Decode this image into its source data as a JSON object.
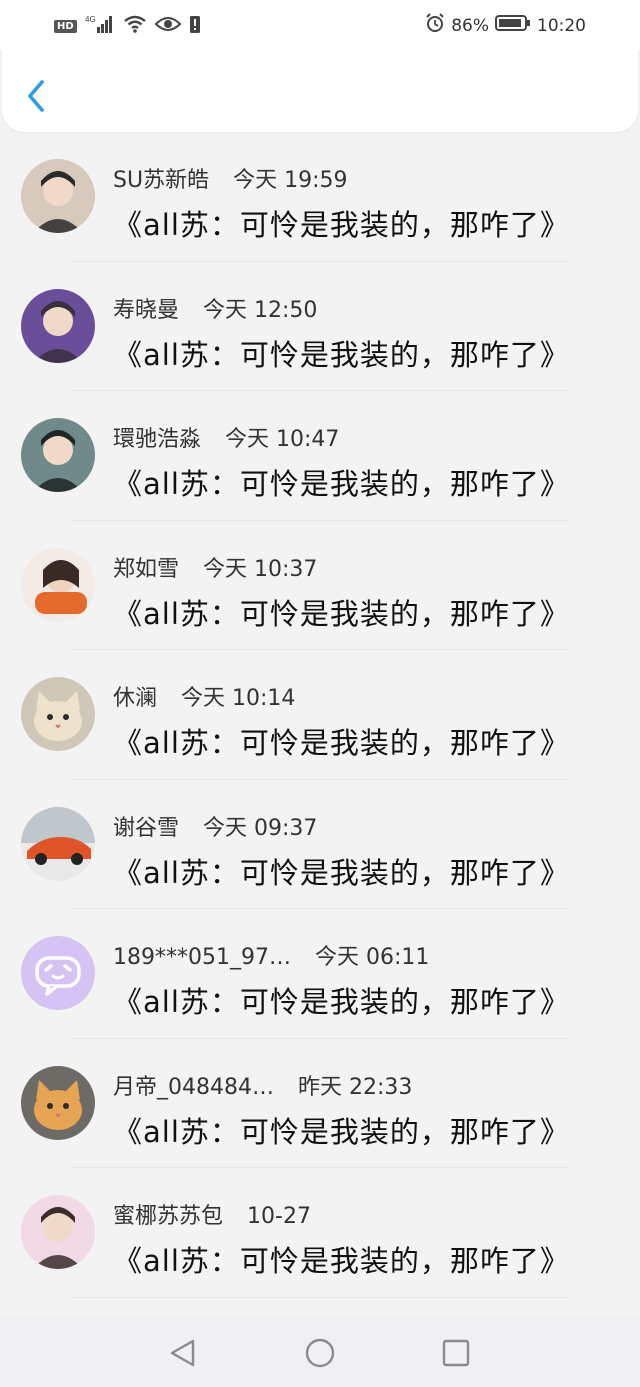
{
  "status_bar": {
    "left_badge": "HD",
    "network": "4G",
    "battery_percent": "86%",
    "time": "10:20"
  },
  "rows": [
    {
      "name": "SU苏新皓",
      "time": "今天 19:59",
      "message": "《all苏：可怜是我装的，那咋了》",
      "avatar": {
        "bg": "#d8c9bd",
        "fg": "#2a2a2a",
        "type": "boy-dark-hair"
      }
    },
    {
      "name": "寿晓曼",
      "time": "今天 12:50",
      "message": "《all苏：可怜是我装的，那咋了》",
      "avatar": {
        "bg": "#6a4e9a",
        "fg": "#3a2f3f",
        "type": "boy-purple"
      }
    },
    {
      "name": "環驰浩淼",
      "time": "今天 10:47",
      "message": "《all苏：可怜是我装的，那咋了》",
      "avatar": {
        "bg": "#6f8a88",
        "fg": "#1f2526",
        "type": "anime-dark"
      }
    },
    {
      "name": "郑如雪",
      "time": "今天 10:37",
      "message": "《all苏：可怜是我装的，那咋了》",
      "avatar": {
        "bg": "#f2ebe6",
        "fg": "#e36a2b",
        "type": "girl-scarf"
      }
    },
    {
      "name": "休澜",
      "time": "今天 10:14",
      "message": "《all苏：可怜是我装的，那咋了》",
      "avatar": {
        "bg": "#cfc7b8",
        "fg": "#efe2cd",
        "type": "cat-light"
      }
    },
    {
      "name": "谢谷雪",
      "time": "今天 09:37",
      "message": "《all苏：可怜是我装的，那咋了》",
      "avatar": {
        "bg": "#e9e9e9",
        "fg": "#e0542a",
        "type": "car-orange"
      }
    },
    {
      "name": "189***051_97…",
      "time": "今天 06:11",
      "message": "《all苏：可怜是我装的，那咋了》",
      "avatar": {
        "bg": "#d4c3f3",
        "fg": "#ffffff",
        "type": "chat-bubble"
      }
    },
    {
      "name": "月帝_048484…",
      "time": "昨天 22:33",
      "message": "《all苏：可怜是我装的，那咋了》",
      "avatar": {
        "bg": "#6e6a66",
        "fg": "#e6a455",
        "type": "cat-orange"
      }
    },
    {
      "name": "蜜梛苏苏包",
      "time": "10-27",
      "message": "《all苏：可怜是我装的，那咋了》",
      "avatar": {
        "bg": "#f2d9e6",
        "fg": "#3b2d2a",
        "type": "boy-pink"
      }
    }
  ],
  "icons": {
    "back": "chevron-left-icon",
    "nav": [
      "back-triangle-icon",
      "home-circle-icon",
      "recents-square-icon"
    ]
  },
  "colors": {
    "accent": "#2e9be3",
    "page_bg": "#f3f3f4"
  }
}
